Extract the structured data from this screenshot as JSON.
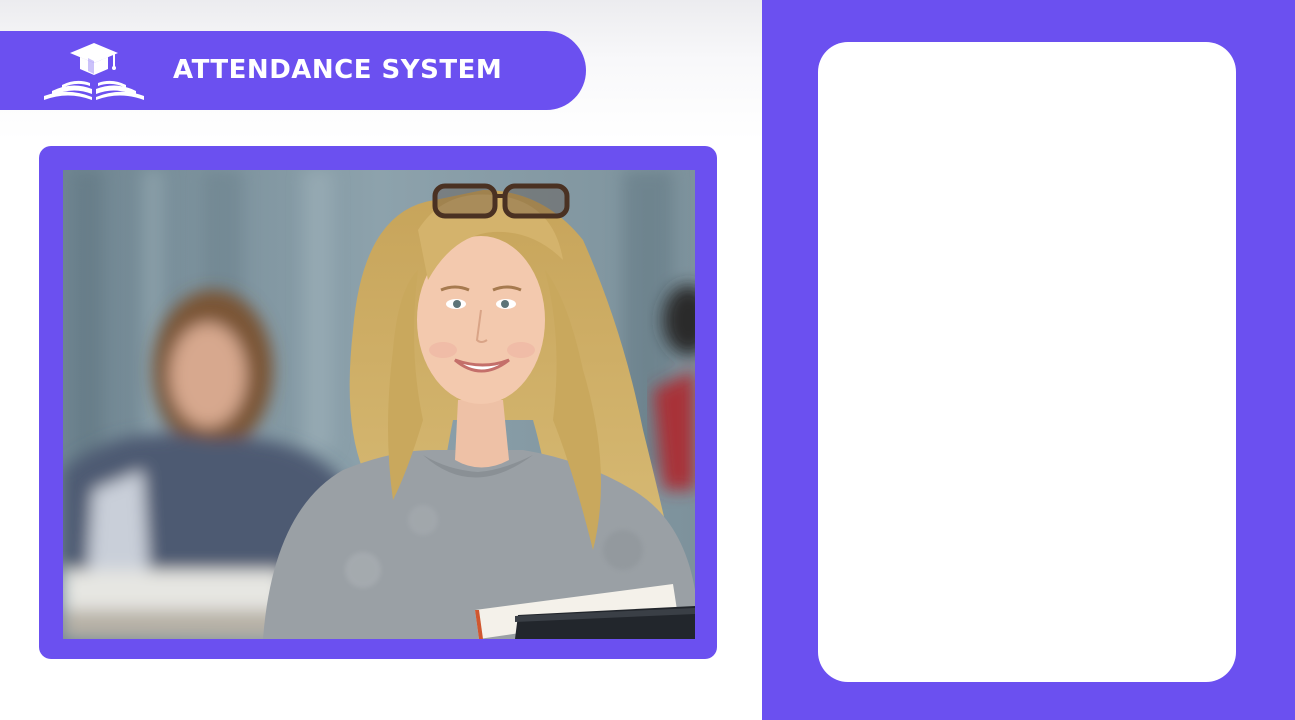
{
  "app": {
    "title": "ATTENDANCE SYSTEM",
    "logo_icon": "graduation-cap-book-icon"
  },
  "colors": {
    "accent": "#6b50f0",
    "card": "#ffffff",
    "background": "#ffffff"
  },
  "camera_feed": {
    "icon": "camera-feed-image"
  },
  "info_panel": {
    "content": ""
  }
}
